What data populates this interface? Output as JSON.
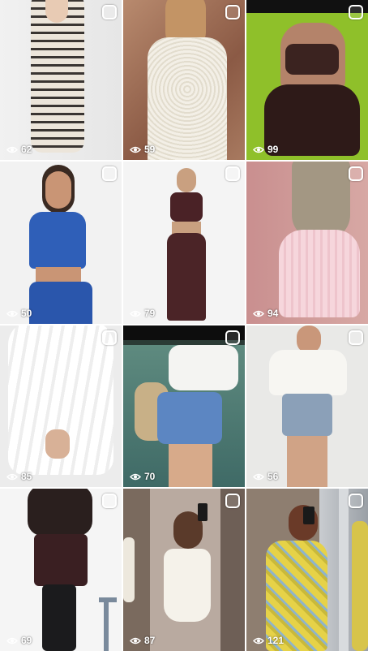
{
  "grid": {
    "tiles": [
      {
        "views": "62"
      },
      {
        "views": "59"
      },
      {
        "views": "99"
      },
      {
        "views": "50"
      },
      {
        "views": "79"
      },
      {
        "views": "94"
      },
      {
        "views": "85"
      },
      {
        "views": "70"
      },
      {
        "views": "56"
      },
      {
        "views": "69"
      },
      {
        "views": "87"
      },
      {
        "views": "121"
      }
    ]
  },
  "icons": {
    "select": "select-square-icon",
    "views": "eye-icon"
  },
  "colors": {
    "overlay_text": "#ffffff",
    "background": "#ffffff"
  }
}
